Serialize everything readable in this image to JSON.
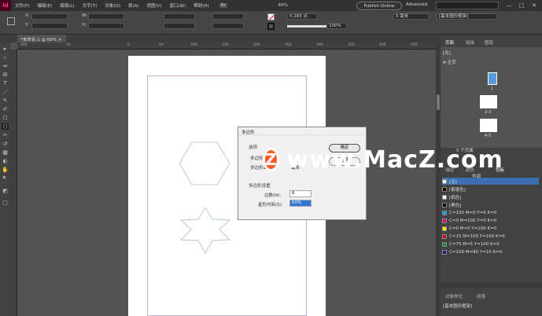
{
  "menubar": {
    "logo": "Id",
    "items": [
      "文件(F)",
      "编辑(E)",
      "版面(L)",
      "文字(T)",
      "对象(O)",
      "表(A)",
      "视图(V)",
      "窗口(W)",
      "帮助(H)"
    ],
    "bridge": "Br",
    "zoom": "69%",
    "publish_label": "Publish Online",
    "workspace": "Advanced",
    "win_min": "—",
    "win_max": "□",
    "win_close": "✕"
  },
  "control": {
    "x_label": "X:",
    "y_label": "Y:",
    "w_label": "W:",
    "h_label": "H:",
    "stroke_weight": "0.283 点",
    "opacity": "100%",
    "size": "5 毫米",
    "object_style": "[基本图形框架]"
  },
  "document_tab": {
    "label": "*未命名-1 @ 69%",
    "close": "×"
  },
  "ruler": {
    "ticks": [
      "100",
      "50",
      "0",
      "50",
      "100",
      "150",
      "200",
      "250",
      "300",
      "350",
      "400",
      "450",
      "500"
    ]
  },
  "tools": [
    "▸",
    "▹",
    "⇔",
    "⊞",
    "T",
    "／",
    "✎",
    "✐",
    "☐",
    "⬡",
    "✂",
    "↺",
    "▦",
    "◐",
    "✋",
    "🔍",
    "◩",
    "▢"
  ],
  "pages_panel": {
    "tabs": [
      "页面",
      "链接",
      "图层"
    ],
    "none_item": "[无]",
    "master": "A-主页",
    "spreads": [
      "1",
      "2-3",
      "4-5"
    ],
    "footer": "5 个页面"
  },
  "swatches_panel": {
    "tabs": [
      "描边",
      "颜色",
      "色板"
    ],
    "tint": "色调",
    "items": [
      {
        "name": "[无]",
        "color": "#ffffff"
      },
      {
        "name": "[套版色]",
        "color": "#000000"
      },
      {
        "name": "[纸色]",
        "color": "#ffffff"
      },
      {
        "name": "[黑色]",
        "color": "#000000"
      },
      {
        "name": "C=100 M=0 Y=0 K=0",
        "color": "#00a0e9"
      },
      {
        "name": "C=0 M=100 Y=0 K=0",
        "color": "#e4007f"
      },
      {
        "name": "C=0 M=0 Y=100 K=0",
        "color": "#fff100"
      },
      {
        "name": "C=15 M=100 Y=100 K=0",
        "color": "#c30d23"
      },
      {
        "name": "C=75 M=5 Y=100 K=0",
        "color": "#009944"
      },
      {
        "name": "C=100 M=90 Y=10 K=0",
        "color": "#1d2088"
      }
    ]
  },
  "styles_panel": {
    "tabs": [
      "对象样式",
      "段落"
    ],
    "current": "[基本图形框架]"
  },
  "dialog": {
    "title": "多边形",
    "options_label": "选项",
    "width_label": "多边形宽度",
    "height_label": "多边形高度",
    "unit": "毫米",
    "ok_label": "确定",
    "cancel_label": "取消",
    "settings_label": "多边形设置",
    "sides_label": "边数(N):",
    "sides_value": "6",
    "inset_label": "星形内陷(S):",
    "inset_value": "50%"
  },
  "watermark": {
    "logo": "Z",
    "text": "www.MacZ.com"
  }
}
